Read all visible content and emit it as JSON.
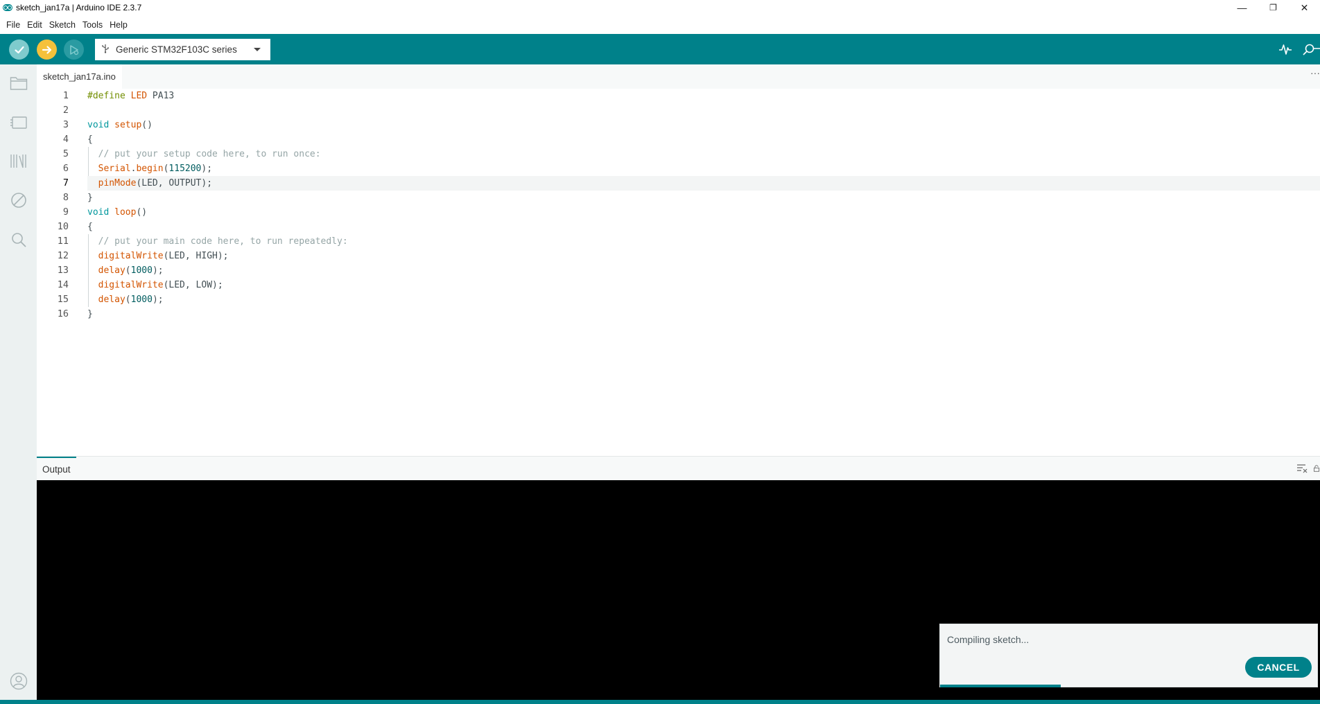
{
  "window": {
    "title": "sketch_jan17a | Arduino IDE 2.3.7",
    "minimize": "—",
    "restore": "❐",
    "close": "✕"
  },
  "menu": [
    "File",
    "Edit",
    "Sketch",
    "Tools",
    "Help"
  ],
  "toolbar": {
    "board": "Generic STM32F103C series"
  },
  "tabs": [
    {
      "label": "sketch_jan17a.ino"
    }
  ],
  "editor": {
    "active_line": 7,
    "lines": [
      {
        "n": "1",
        "text": "#define LED PA13"
      },
      {
        "n": "2",
        "text": ""
      },
      {
        "n": "3",
        "text": "void setup()"
      },
      {
        "n": "4",
        "text": "{"
      },
      {
        "n": "5",
        "text": "  // put your setup code here, to run once:"
      },
      {
        "n": "6",
        "text": "  Serial.begin(115200);"
      },
      {
        "n": "7",
        "text": "  pinMode(LED, OUTPUT);"
      },
      {
        "n": "8",
        "text": "}"
      },
      {
        "n": "9",
        "text": "void loop()"
      },
      {
        "n": "10",
        "text": "{"
      },
      {
        "n": "11",
        "text": "  // put your main code here, to run repeatedly:"
      },
      {
        "n": "12",
        "text": "  digitalWrite(LED, HIGH);"
      },
      {
        "n": "13",
        "text": "  delay(1000);"
      },
      {
        "n": "14",
        "text": "  digitalWrite(LED, LOW);"
      },
      {
        "n": "15",
        "text": "  delay(1000);"
      },
      {
        "n": "16",
        "text": "}"
      }
    ]
  },
  "output": {
    "tab_label": "Output"
  },
  "notification": {
    "message": "Compiling sketch...",
    "cancel_label": "CANCEL",
    "progress": 0.32
  },
  "colors": {
    "accent": "#00818a",
    "upload": "#f5c13b",
    "verify": "#7fcbcd"
  }
}
